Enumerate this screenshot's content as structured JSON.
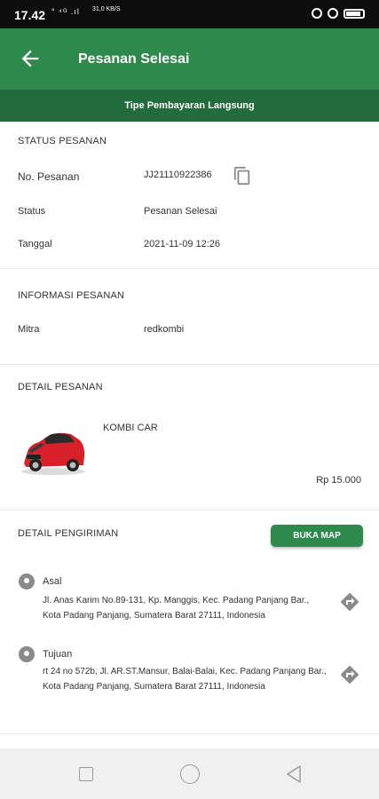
{
  "status_bar": {
    "time": "17.42",
    "indicators": "° ⁴ᴳ .ıl",
    "network": "31,0 KB/S"
  },
  "app_bar": {
    "title": "Pesanan Selesai",
    "back_icon": "arrow-left-icon"
  },
  "payment_bar": {
    "text": "Tipe Pembayaran Langsung"
  },
  "status_section": {
    "title": "STATUS PESANAN",
    "order_no_label": "No. Pesanan",
    "order_no": "JJ21110922386",
    "status_label": "Status",
    "status": "Pesanan Selesai",
    "date_label": "Tanggal",
    "date": "2021-11-09 12:26"
  },
  "info_section": {
    "title": "INFORMASI PESANAN",
    "partner_label": "Mitra",
    "partner": "redkombi"
  },
  "detail_section": {
    "title": "DETAIL PESANAN",
    "product": "KOMBI CAR",
    "price": "Rp 15.000"
  },
  "shipping_section": {
    "title": "DETAIL PENGIRIMAN",
    "map_button": "BUKA MAP",
    "origin_label": "Asal",
    "origin_address": "Jl. Anas Karim No.89-131, Kp. Manggis, Kec. Padang Panjang Bar., Kota Padang Panjang, Sumatera Barat 27111, Indonesia",
    "destination_label": "Tujuan",
    "destination_address": "rt 24 no 572b, Jl. AR.ST.Mansur, Balai-Balai, Kec. Padang Panjang Bar., Kota Padang Panjang, Sumatera Barat 27111, Indonesia"
  },
  "colors": {
    "primary": "#2e8a4c",
    "primary_dark": "#226b3c",
    "car": "#d8202a"
  }
}
